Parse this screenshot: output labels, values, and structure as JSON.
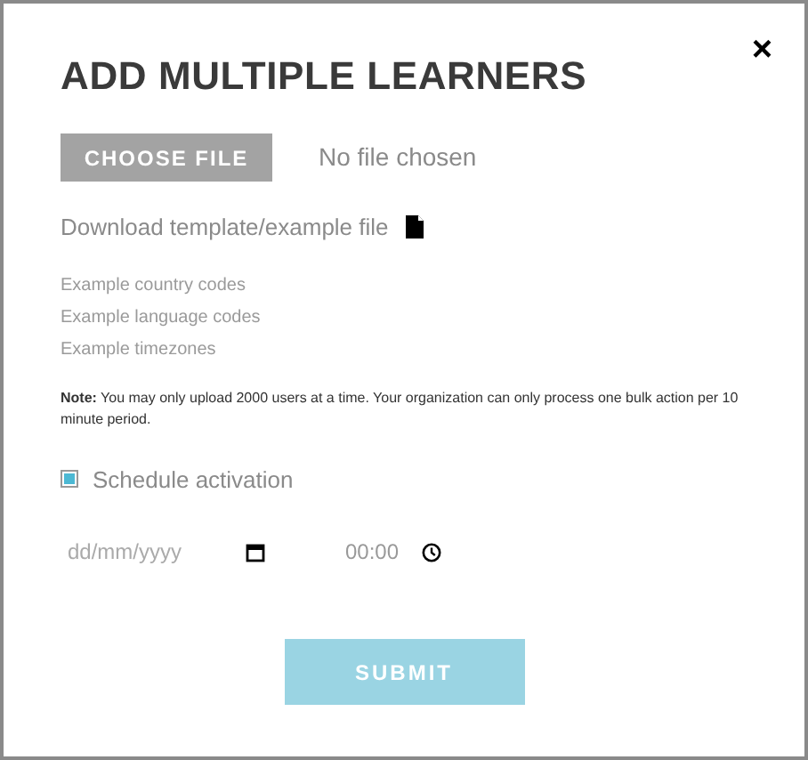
{
  "dialog": {
    "title": "ADD MULTIPLE LEARNERS",
    "close": "×"
  },
  "file_picker": {
    "button": "CHOOSE FILE",
    "status": "No file chosen"
  },
  "download_link": "Download template/example file",
  "example_links": [
    "Example country codes",
    "Example language codes",
    "Example timezones"
  ],
  "note": "**Note:** You may only upload 2000 users at a time. Your organization can only process one bulk action per 10 minute period.",
  "schedule": {
    "label": "Schedule activation",
    "checked": true
  },
  "date_field": {
    "placeholder": "dd/mm/yyyy"
  },
  "time_field": {
    "value": "00:00"
  },
  "submit": {
    "label": "SUBMIT",
    "disabled": true
  }
}
